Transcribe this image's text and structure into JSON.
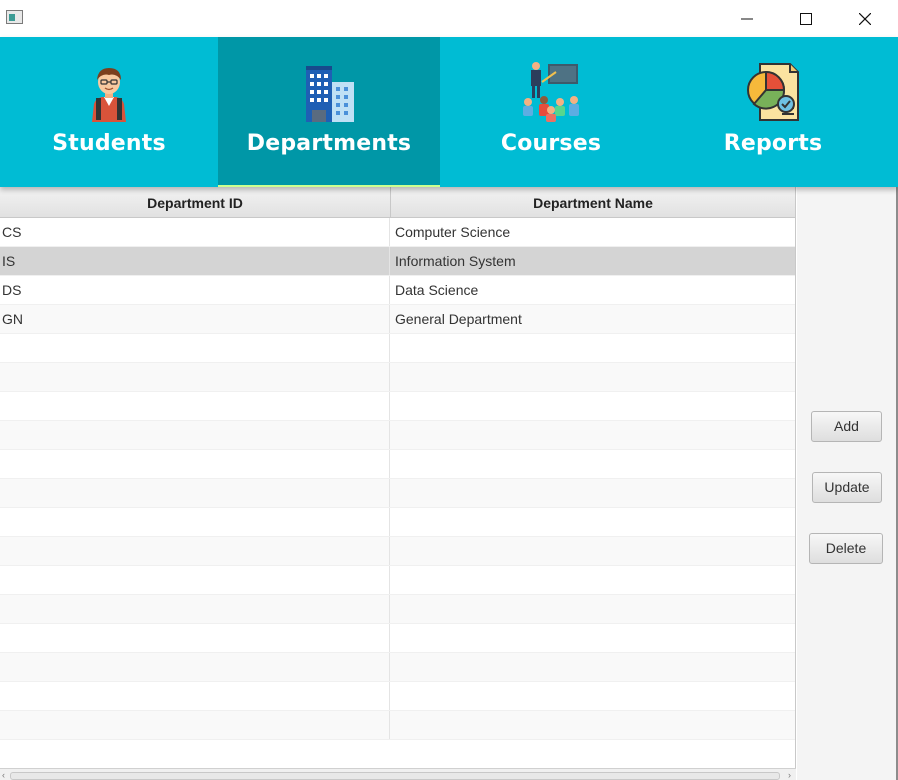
{
  "window": {
    "controls": [
      "minimize",
      "maximize",
      "close"
    ]
  },
  "nav": {
    "tabs": [
      {
        "label": "Students",
        "icon": "student-icon",
        "active": false
      },
      {
        "label": "Departments",
        "icon": "buildings-icon",
        "active": true
      },
      {
        "label": "Courses",
        "icon": "classroom-icon",
        "active": false
      },
      {
        "label": "Reports",
        "icon": "report-chart-icon",
        "active": false
      }
    ]
  },
  "table": {
    "columns": [
      "Department ID",
      "Department Name"
    ],
    "rows": [
      {
        "id": "CS",
        "name": "Computer Science"
      },
      {
        "id": "IS",
        "name": "Information System"
      },
      {
        "id": "DS",
        "name": "Data Science"
      },
      {
        "id": "GN",
        "name": "General Department"
      }
    ],
    "selected_row": 1
  },
  "actions": {
    "add_label": "Add",
    "update_label": "Update",
    "delete_label": "Delete"
  },
  "colors": {
    "nav_bg": "#00bcd4",
    "nav_active": "#0097a7",
    "active_underline": "#ccff90",
    "selected_row": "#d4d4d4"
  }
}
